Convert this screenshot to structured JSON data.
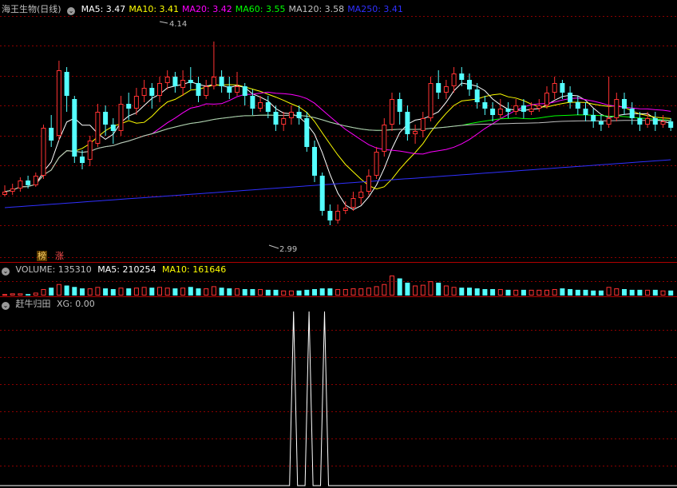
{
  "stock": {
    "title": "海王生物(日线)"
  },
  "main_panel": {
    "ma_labels": [
      {
        "label": "MA5: 3.47",
        "color": "#ffffff"
      },
      {
        "label": "MA10: 3.41",
        "color": "#ffff00"
      },
      {
        "label": "MA20: 3.42",
        "color": "#ff00ff"
      },
      {
        "label": "MA60: 3.55",
        "color": "#00ff00"
      },
      {
        "label": "MA120: 3.58",
        "color": "#c0c0c0"
      },
      {
        "label": "MA250: 3.41",
        "color": "#3030ff"
      }
    ],
    "high_label": "4.14",
    "low_label": "2.99",
    "badges": [
      "榜",
      "涨"
    ]
  },
  "volume_panel": {
    "label": "VOLUME: 135310",
    "ma5": "MA5: 210254",
    "ma10": "MA10: 161646"
  },
  "indicator_panel": {
    "label": "赶牛归田",
    "value": "XG: 0.00"
  },
  "colors": {
    "up": "#ff3232",
    "down": "#54ffff",
    "grid": "#8b0000",
    "ma5": "#ffffff",
    "ma10": "#ffff00",
    "ma20": "#ff00ff",
    "ma60": "#00ff00",
    "ma120": "#c0c0c0",
    "ma250": "#3030ff"
  },
  "chart_data": {
    "type": "candlestick",
    "ylim": [
      2.9,
      4.3
    ],
    "high": 4.14,
    "low": 2.99,
    "candles": [
      [
        3.18,
        3.2,
        3.24,
        3.17
      ],
      [
        3.2,
        3.22,
        3.25,
        3.18
      ],
      [
        3.22,
        3.27,
        3.29,
        3.2
      ],
      [
        3.27,
        3.24,
        3.3,
        3.22
      ],
      [
        3.24,
        3.3,
        3.32,
        3.23
      ],
      [
        3.3,
        3.6,
        3.62,
        3.28
      ],
      [
        3.6,
        3.52,
        3.68,
        3.48
      ],
      [
        3.55,
        3.96,
        4.02,
        3.52
      ],
      [
        3.95,
        3.8,
        3.98,
        3.7
      ],
      [
        3.78,
        3.42,
        3.8,
        3.38
      ],
      [
        3.42,
        3.38,
        3.46,
        3.34
      ],
      [
        3.4,
        3.52,
        3.55,
        3.36
      ],
      [
        3.5,
        3.7,
        3.75,
        3.48
      ],
      [
        3.7,
        3.62,
        3.74,
        3.55
      ],
      [
        3.62,
        3.58,
        3.66,
        3.5
      ],
      [
        3.58,
        3.75,
        3.8,
        3.55
      ],
      [
        3.75,
        3.72,
        3.82,
        3.65
      ],
      [
        3.72,
        3.8,
        3.85,
        3.68
      ],
      [
        3.8,
        3.85,
        3.9,
        3.76
      ],
      [
        3.85,
        3.8,
        3.88,
        3.72
      ],
      [
        3.8,
        3.88,
        3.92,
        3.76
      ],
      [
        3.88,
        3.92,
        3.96,
        3.84
      ],
      [
        3.92,
        3.86,
        3.95,
        3.82
      ],
      [
        3.85,
        3.9,
        3.96,
        3.8
      ],
      [
        3.9,
        3.88,
        3.98,
        3.84
      ],
      [
        3.88,
        3.8,
        3.92,
        3.76
      ],
      [
        3.8,
        3.86,
        3.9,
        3.78
      ],
      [
        3.86,
        3.92,
        4.14,
        3.84
      ],
      [
        3.92,
        3.86,
        3.96,
        3.82
      ],
      [
        3.86,
        3.82,
        3.92,
        3.78
      ],
      [
        3.82,
        3.86,
        3.95,
        3.8
      ],
      [
        3.86,
        3.8,
        3.88,
        3.74
      ],
      [
        3.8,
        3.72,
        3.84,
        3.68
      ],
      [
        3.72,
        3.76,
        3.8,
        3.7
      ],
      [
        3.76,
        3.7,
        3.8,
        3.66
      ],
      [
        3.7,
        3.62,
        3.74,
        3.58
      ],
      [
        3.62,
        3.66,
        3.7,
        3.58
      ],
      [
        3.66,
        3.7,
        3.74,
        3.62
      ],
      [
        3.7,
        3.66,
        3.74,
        3.62
      ],
      [
        3.66,
        3.48,
        3.7,
        3.45
      ],
      [
        3.48,
        3.3,
        3.52,
        3.26
      ],
      [
        3.3,
        3.08,
        3.32,
        3.05
      ],
      [
        3.08,
        3.02,
        3.12,
        2.99
      ],
      [
        3.02,
        3.08,
        3.12,
        3.0
      ],
      [
        3.08,
        3.1,
        3.14,
        3.06
      ],
      [
        3.1,
        3.16,
        3.2,
        3.08
      ],
      [
        3.16,
        3.2,
        3.24,
        3.12
      ],
      [
        3.2,
        3.3,
        3.34,
        3.18
      ],
      [
        3.3,
        3.45,
        3.48,
        3.28
      ],
      [
        3.45,
        3.62,
        3.66,
        3.42
      ],
      [
        3.62,
        3.78,
        3.82,
        3.58
      ],
      [
        3.78,
        3.7,
        3.82,
        3.62
      ],
      [
        3.7,
        3.56,
        3.74,
        3.52
      ],
      [
        3.56,
        3.58,
        3.62,
        3.5
      ],
      [
        3.58,
        3.66,
        3.7,
        3.54
      ],
      [
        3.66,
        3.88,
        3.92,
        3.64
      ],
      [
        3.88,
        3.82,
        3.96,
        3.78
      ],
      [
        3.82,
        3.86,
        3.9,
        3.78
      ],
      [
        3.86,
        3.94,
        3.98,
        3.82
      ],
      [
        3.94,
        3.9,
        3.98,
        3.86
      ],
      [
        3.9,
        3.84,
        3.94,
        3.8
      ],
      [
        3.84,
        3.76,
        3.88,
        3.72
      ],
      [
        3.76,
        3.72,
        3.8,
        3.68
      ],
      [
        3.72,
        3.68,
        3.76,
        3.64
      ],
      [
        3.68,
        3.72,
        3.78,
        3.66
      ],
      [
        3.72,
        3.7,
        3.76,
        3.66
      ],
      [
        3.7,
        3.74,
        3.78,
        3.68
      ],
      [
        3.74,
        3.7,
        3.78,
        3.66
      ],
      [
        3.7,
        3.72,
        3.76,
        3.68
      ],
      [
        3.72,
        3.74,
        3.78,
        3.7
      ],
      [
        3.74,
        3.82,
        3.86,
        3.72
      ],
      [
        3.82,
        3.88,
        3.92,
        3.78
      ],
      [
        3.88,
        3.82,
        3.9,
        3.78
      ],
      [
        3.82,
        3.76,
        3.86,
        3.72
      ],
      [
        3.76,
        3.72,
        3.8,
        3.68
      ],
      [
        3.72,
        3.68,
        3.76,
        3.64
      ],
      [
        3.68,
        3.64,
        3.72,
        3.6
      ],
      [
        3.64,
        3.62,
        3.68,
        3.58
      ],
      [
        3.62,
        3.66,
        3.92,
        3.6
      ],
      [
        3.66,
        3.78,
        3.82,
        3.64
      ],
      [
        3.78,
        3.72,
        3.82,
        3.68
      ],
      [
        3.72,
        3.66,
        3.76,
        3.62
      ],
      [
        3.66,
        3.62,
        3.7,
        3.58
      ],
      [
        3.62,
        3.66,
        3.7,
        3.6
      ],
      [
        3.66,
        3.62,
        3.7,
        3.58
      ],
      [
        3.62,
        3.64,
        3.68,
        3.6
      ],
      [
        3.64,
        3.6,
        3.66,
        3.58
      ]
    ],
    "volume": [
      2,
      3,
      3,
      2,
      4,
      9,
      11,
      16,
      14,
      12,
      10,
      10,
      12,
      10,
      9,
      11,
      10,
      11,
      12,
      11,
      12,
      11,
      10,
      11,
      12,
      10,
      10,
      13,
      11,
      10,
      10,
      9,
      9,
      9,
      8,
      8,
      7,
      7,
      7,
      8,
      9,
      10,
      10,
      9,
      9,
      10,
      10,
      11,
      13,
      16,
      28,
      24,
      18,
      14,
      15,
      20,
      18,
      14,
      12,
      11,
      11,
      10,
      9,
      9,
      9,
      8,
      8,
      8,
      8,
      8,
      8,
      9,
      10,
      9,
      8,
      8,
      7,
      7,
      12,
      10,
      9,
      8,
      8,
      8,
      8,
      7,
      7
    ],
    "xg_spikes": [
      41,
      43,
      45
    ]
  }
}
